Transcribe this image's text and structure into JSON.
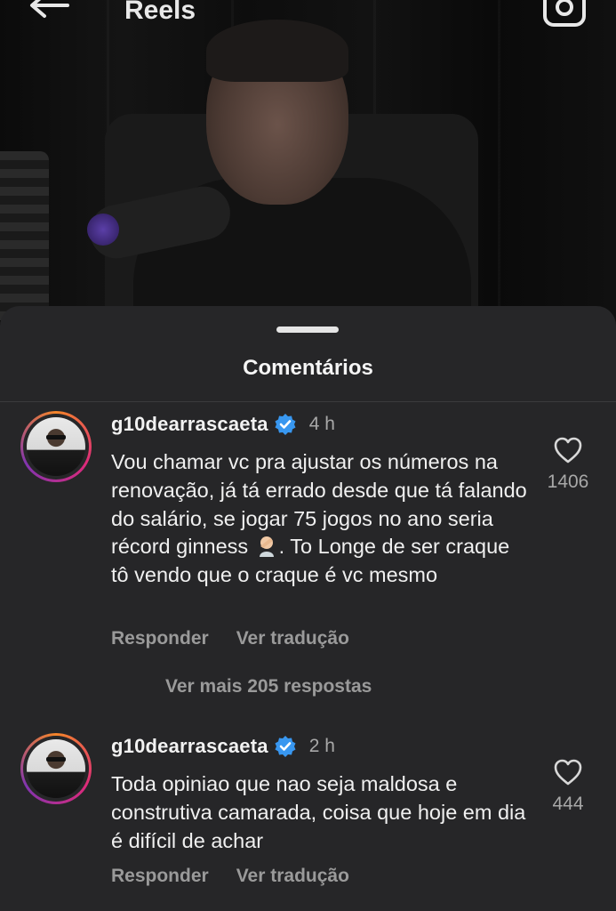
{
  "header": {
    "title": "Reels"
  },
  "sheet": {
    "title": "Comentários"
  },
  "comments": [
    {
      "username": "g10dearrascaeta",
      "time": "4 h",
      "text_before_emoji": "Vou chamar vc pra ajustar os números na renovação, já tá errado desde que tá falando do salário, se jogar 75 jogos no ano seria récord ginness",
      "text_after_emoji": ". To Longe de ser craque tô vendo que o craque é vc mesmo",
      "likes": "1406",
      "reply_label": "Responder",
      "translate_label": "Ver tradução"
    },
    {
      "username": "g10dearrascaeta",
      "time": "2 h",
      "text": "Toda opiniao que nao seja maldosa e construtiva camarada, coisa que hoje em dia é difícil de achar",
      "likes": "444",
      "reply_label": "Responder",
      "translate_label": "Ver tradução"
    }
  ],
  "more_replies": "Ver mais 205 respostas",
  "colors": {
    "sheet_bg": "#262628",
    "verified": "#3897f0",
    "muted_text": "#9a9a9a"
  }
}
